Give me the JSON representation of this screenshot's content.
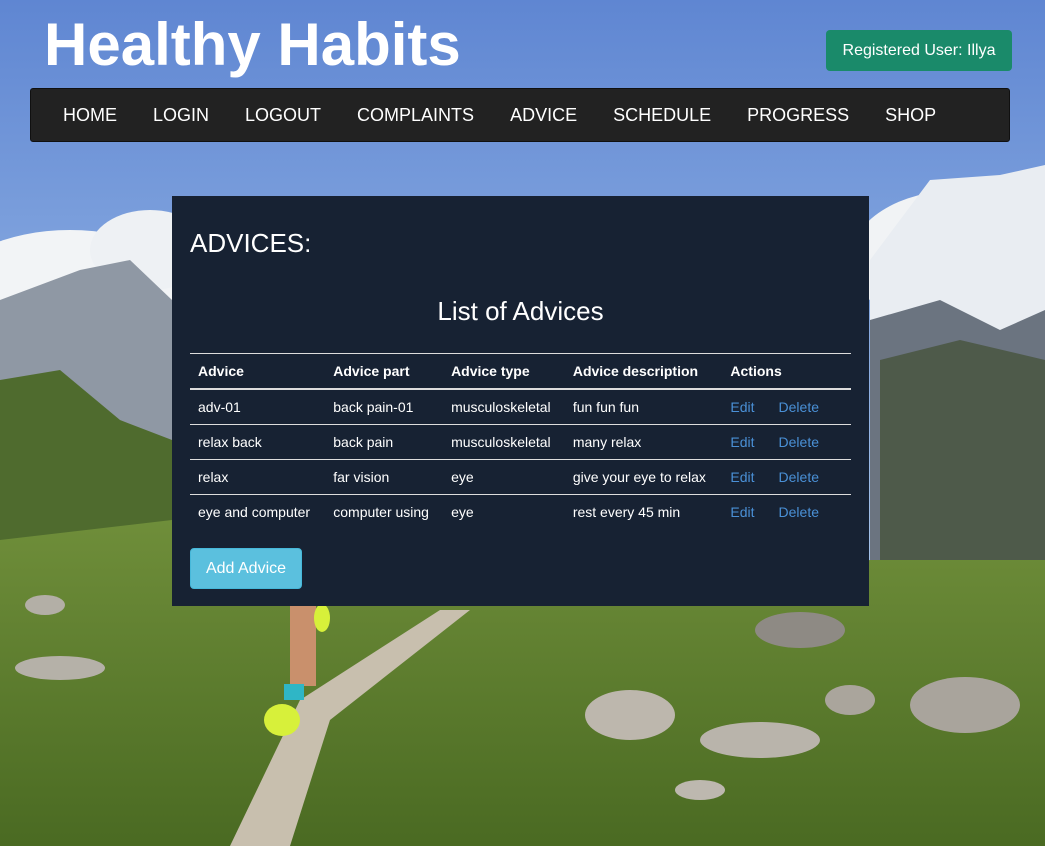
{
  "header": {
    "site_title": "Healthy Habits",
    "user_badge": "Registered User: Illya"
  },
  "nav": {
    "items": [
      {
        "label": "HOME"
      },
      {
        "label": "LOGIN"
      },
      {
        "label": "LOGOUT"
      },
      {
        "label": "COMPLAINTS"
      },
      {
        "label": "ADVICE"
      },
      {
        "label": "SCHEDULE"
      },
      {
        "label": "PROGRESS"
      },
      {
        "label": "SHOP"
      }
    ]
  },
  "panel": {
    "heading": "ADVICES:",
    "list_title": "List of Advices",
    "columns": [
      "Advice",
      "Advice part",
      "Advice type",
      "Advice description",
      "Actions"
    ],
    "rows": [
      {
        "advice": "adv-01",
        "part": "back pain-01",
        "type": "musculoskeletal",
        "description": "fun fun fun",
        "edit": "Edit",
        "delete": "Delete"
      },
      {
        "advice": "relax back",
        "part": "back pain",
        "type": "musculoskeletal",
        "description": "many relax",
        "edit": "Edit",
        "delete": "Delete"
      },
      {
        "advice": "relax",
        "part": "far vision",
        "type": "eye",
        "description": "give your eye to relax",
        "edit": "Edit",
        "delete": "Delete"
      },
      {
        "advice": "eye and computer",
        "part": "computer using",
        "type": "eye",
        "description": "rest every 45 min",
        "edit": "Edit",
        "delete": "Delete"
      }
    ],
    "add_button": "Add Advice"
  },
  "colors": {
    "panel_bg": "#172233",
    "navbar_bg": "#222222",
    "badge_bg": "#1a8a6a",
    "add_button_bg": "#5bc0de",
    "link": "#4a90d6"
  }
}
